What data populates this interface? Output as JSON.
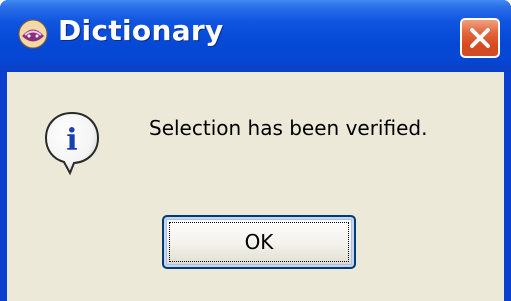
{
  "window": {
    "title": "Dictionary",
    "app_icon": "dictionary-app-icon",
    "close_icon": "close-icon"
  },
  "dialog": {
    "icon": "information-icon",
    "icon_glyph": "i",
    "message": "Selection has been verified.",
    "ok_label": "OK"
  },
  "colors": {
    "titlebar": "#0549d6",
    "client_bg": "#ece9d8",
    "close_button": "#e2663c",
    "info_icon": "#1a3fb0"
  }
}
